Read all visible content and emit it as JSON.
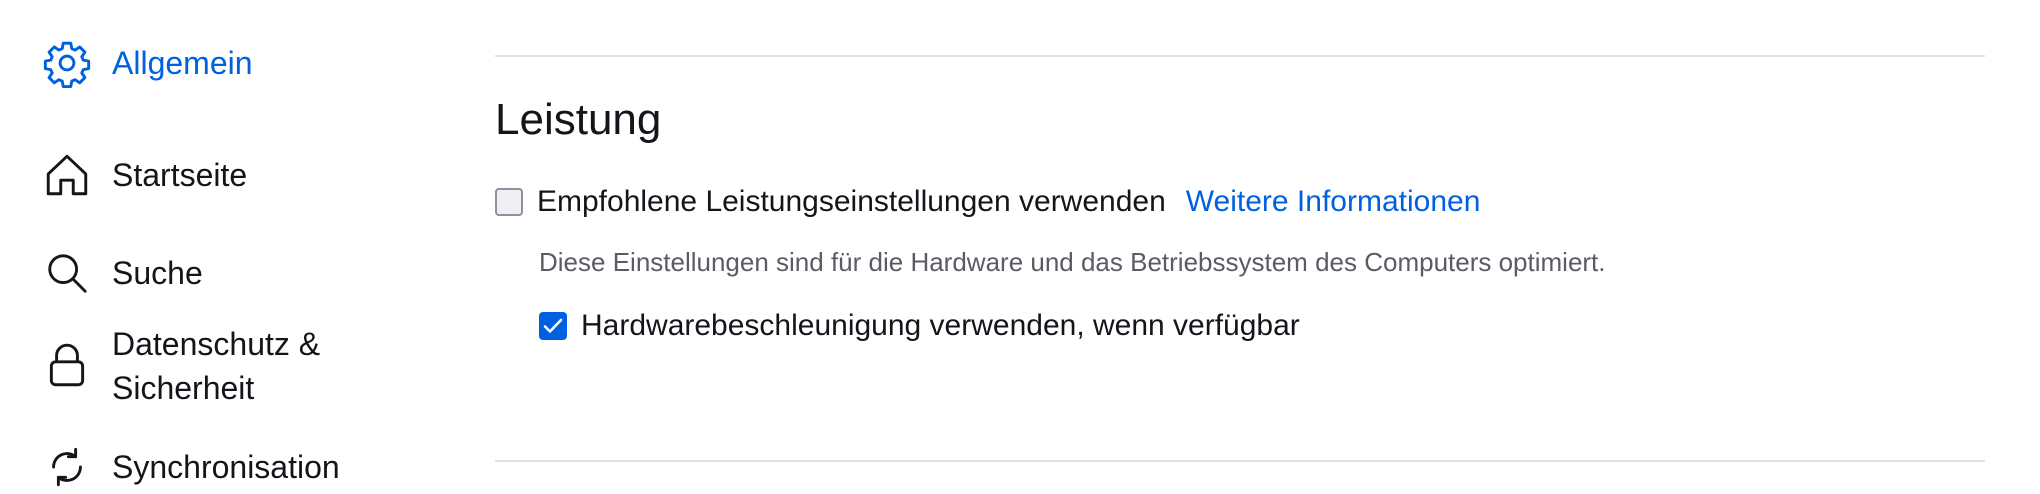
{
  "sidebar": {
    "items": [
      {
        "label": "Allgemein",
        "icon": "gear-icon",
        "active": true
      },
      {
        "label": "Startseite",
        "icon": "home-icon"
      },
      {
        "label": "Suche",
        "icon": "search-icon"
      },
      {
        "label": "Datenschutz & Sicherheit",
        "icon": "lock-icon"
      },
      {
        "label": "Synchronisation",
        "icon": "sync-icon"
      }
    ]
  },
  "performance": {
    "title": "Leistung",
    "recommended": {
      "label": "Empfohlene Leistungseinstellungen verwenden",
      "checked": false,
      "learn_more": "Weitere Informationen"
    },
    "description": "Diese Einstellungen sind für die Hardware und das Betriebssystem des Computers optimiert.",
    "hardware_acceleration": {
      "label": "Hardwarebeschleunigung verwenden, wenn verfügbar",
      "checked": true
    }
  },
  "colors": {
    "accent": "#0061e0",
    "text": "#15141a",
    "muted": "#5b5b66",
    "divider": "#e0e0e6"
  }
}
